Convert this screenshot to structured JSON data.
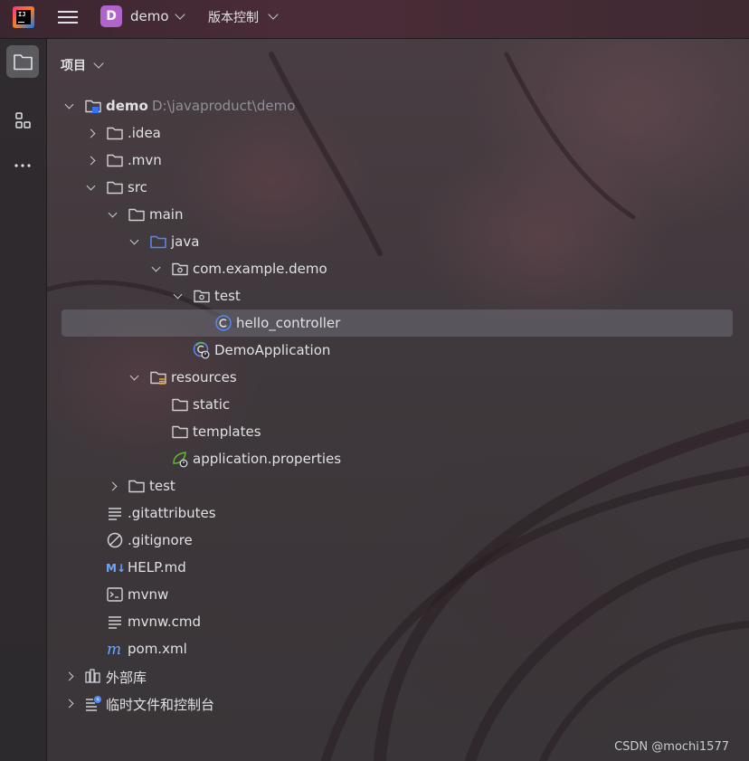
{
  "titlebar": {
    "project_badge": "D",
    "project_name": "demo",
    "vcs_menu": "版本控制"
  },
  "panel": {
    "title": "项目"
  },
  "tree": [
    {
      "label": "demo",
      "path": "D:\\javaproduct\\demo",
      "bold": true,
      "icon": "module-folder-icon",
      "arrow": "open"
    },
    {
      "label": ".idea",
      "icon": "folder-icon",
      "arrow": "closed"
    },
    {
      "label": ".mvn",
      "icon": "folder-icon",
      "arrow": "closed"
    },
    {
      "label": "src",
      "icon": "folder-icon",
      "arrow": "open"
    },
    {
      "label": "main",
      "icon": "folder-icon",
      "arrow": "open"
    },
    {
      "label": "java",
      "icon": "source-folder-icon",
      "arrow": "open"
    },
    {
      "label": "com.example.demo",
      "icon": "package-icon",
      "arrow": "open"
    },
    {
      "label": "test",
      "icon": "package-icon",
      "arrow": "open"
    },
    {
      "label": "hello_controller",
      "icon": "java-class-icon",
      "arrow": "none",
      "selected": true
    },
    {
      "label": "DemoApplication",
      "icon": "spring-boot-class-icon",
      "arrow": "none"
    },
    {
      "label": "resources",
      "icon": "resources-folder-icon",
      "arrow": "open"
    },
    {
      "label": "static",
      "icon": "folder-icon",
      "arrow": "none"
    },
    {
      "label": "templates",
      "icon": "folder-icon",
      "arrow": "none"
    },
    {
      "label": "application.properties",
      "icon": "spring-properties-icon",
      "arrow": "none"
    },
    {
      "label": "test",
      "icon": "folder-icon",
      "arrow": "closed"
    },
    {
      "label": ".gitattributes",
      "icon": "text-file-icon",
      "arrow": "none"
    },
    {
      "label": ".gitignore",
      "icon": "ignore-file-icon",
      "arrow": "none"
    },
    {
      "label": "HELP.md",
      "icon": "markdown-icon",
      "arrow": "none"
    },
    {
      "label": "mvnw",
      "icon": "shell-script-icon",
      "arrow": "none"
    },
    {
      "label": "mvnw.cmd",
      "icon": "text-file-icon",
      "arrow": "none"
    },
    {
      "label": "pom.xml",
      "icon": "maven-icon",
      "arrow": "none"
    },
    {
      "label": "外部库",
      "icon": "library-icon",
      "arrow": "closed"
    },
    {
      "label": "临时文件和控制台",
      "icon": "scratches-icon",
      "arrow": "closed"
    }
  ],
  "watermark": "CSDN @mochi1577",
  "colors": {
    "selection": "#5a5a60",
    "project_badge": "#b163cc",
    "java_blue": "#548af7"
  }
}
